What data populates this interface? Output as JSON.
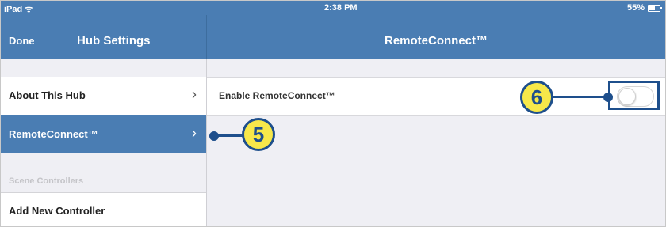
{
  "status_bar": {
    "device": "iPad",
    "time": "2:38 PM",
    "battery": "55%"
  },
  "left_nav": {
    "done_label": "Done",
    "title": "Hub Settings"
  },
  "right_nav": {
    "title": "RemoteConnect™"
  },
  "sidebar": {
    "items": [
      {
        "label": "About This Hub",
        "chevron": "›"
      },
      {
        "label": "RemoteConnect™",
        "chevron": "›"
      }
    ],
    "section_header": "Scene Controllers",
    "section_items": [
      {
        "label": "Add New Controller"
      }
    ]
  },
  "setting": {
    "label": "Enable RemoteConnect™",
    "toggle_on": false
  },
  "callouts": {
    "five": "5",
    "six": "6"
  },
  "colors": {
    "nav_blue": "#4a7db3",
    "callout_yellow": "#f7e84a",
    "callout_blue": "#1e4f8c"
  }
}
